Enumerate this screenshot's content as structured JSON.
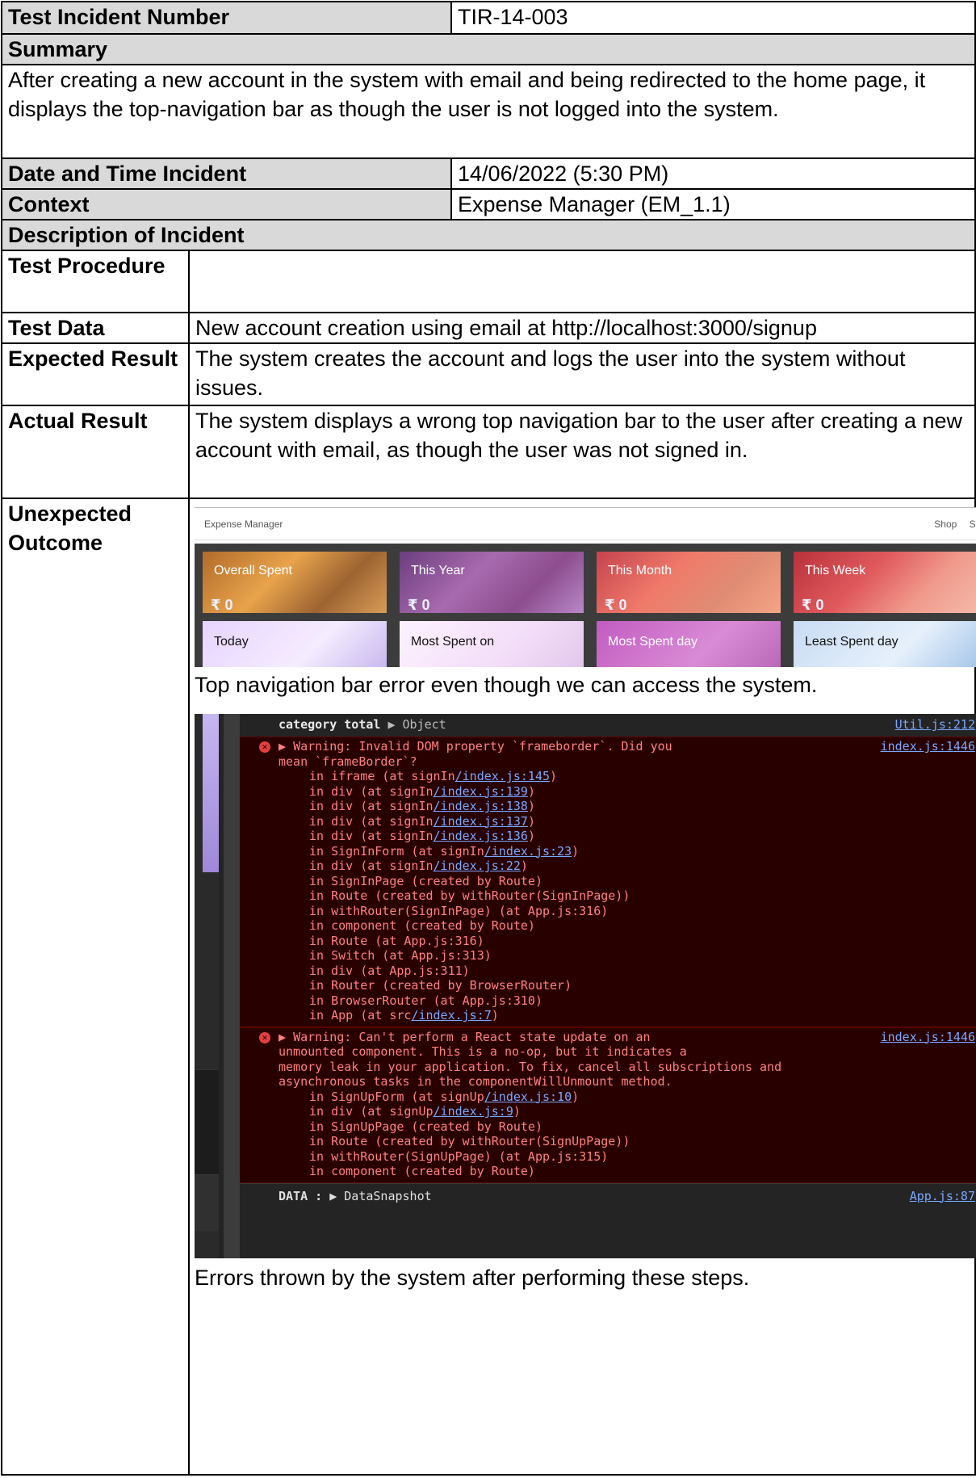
{
  "header": {
    "label": "Test Incident Number",
    "value": "TIR-14-003"
  },
  "summary": {
    "label": "Summary",
    "text": "After creating a new account in the system with email and being redirected to the home page, it displays the top-navigation bar as though the user is not logged into the system."
  },
  "date_time": {
    "label": "Date and Time Incident",
    "value": "14/06/2022 (5:30 PM)"
  },
  "context": {
    "label": "Context",
    "value": "Expense Manager (EM_1.1)"
  },
  "description": {
    "label": "Description of Incident"
  },
  "rows": {
    "procedure_label": "Test Procedure",
    "procedure_value": "",
    "test_data_label": "Test Data",
    "test_data_value": "New account creation using email at http://localhost:3000/signup",
    "expected_label": "Expected Result",
    "expected_value": "The system creates the account and logs the user into the system without issues.",
    "actual_label": "Actual Result",
    "actual_value": "The system displays a wrong top navigation bar to the user after creating a new account with email, as though the user was not signed in.",
    "unexpected_label": "Unexpected Outcome"
  },
  "shot1": {
    "app_title": "Expense Manager",
    "nav_shop": "Shop",
    "nav_signin": "Sign In",
    "tiles": [
      {
        "label": "Overall Spent",
        "amount": "₹ 0"
      },
      {
        "label": "This Year",
        "amount": "₹ 0"
      },
      {
        "label": "This Month",
        "amount": "₹ 0"
      },
      {
        "label": "This Week",
        "amount": "₹ 0"
      },
      {
        "label": "Today"
      },
      {
        "label": "Most Spent on"
      },
      {
        "label": "Most Spent day"
      },
      {
        "label": "Least Spent day"
      }
    ],
    "caption": "Top navigation bar error even though we can access the system."
  },
  "shot2": {
    "first_row_key": "category total",
    "first_row_obj": "Object",
    "first_row_src": "Util.js:212",
    "error1": {
      "line1": "Warning: Invalid DOM property `frameborder`. Did you",
      "line2": "mean `frameBorder`?",
      "src": "index.js:1446",
      "stack": [
        [
          "in iframe (at signIn",
          "/index.js:145",
          ")"
        ],
        [
          "in div (at signIn",
          "/index.js:139",
          ")"
        ],
        [
          "in div (at signIn",
          "/index.js:138",
          ")"
        ],
        [
          "in div (at signIn",
          "/index.js:137",
          ")"
        ],
        [
          "in div (at signIn",
          "/index.js:136",
          ")"
        ],
        [
          "in SignInForm (at signIn",
          "/index.js:23",
          ")"
        ],
        [
          "in div (at signIn",
          "/index.js:22",
          ")"
        ],
        [
          "in SignInPage (created by Route)",
          "",
          ""
        ],
        [
          "in Route (created by withRouter(SignInPage))",
          "",
          ""
        ],
        [
          "in withRouter(SignInPage) (at App.js:316)",
          "",
          ""
        ],
        [
          "in component (created by Route)",
          "",
          ""
        ],
        [
          "in Route (at App.js:316)",
          "",
          ""
        ],
        [
          "in Switch (at App.js:313)",
          "",
          ""
        ],
        [
          "in div (at App.js:311)",
          "",
          ""
        ],
        [
          "in Router (created by BrowserRouter)",
          "",
          ""
        ],
        [
          "in BrowserRouter (at App.js:310)",
          "",
          ""
        ],
        [
          "in App (at src",
          "/index.js:7",
          ")"
        ]
      ]
    },
    "error2": {
      "line1": "Warning: Can't perform a React state update on an",
      "line2": "unmounted component. This is a no-op, but it indicates a",
      "line3": "memory leak in your application. To fix, cancel all subscriptions and",
      "line4": "asynchronous tasks in the componentWillUnmount method.",
      "src": "index.js:1446",
      "stack": [
        [
          "in SignUpForm (at signUp",
          "/index.js:10",
          ")"
        ],
        [
          "in div (at signUp",
          "/index.js:9",
          ")"
        ],
        [
          "in SignUpPage (created by Route)",
          "",
          ""
        ],
        [
          "in Route (created by withRouter(SignUpPage))",
          "",
          ""
        ],
        [
          "in withRouter(SignUpPage) (at App.js:315)",
          "",
          ""
        ],
        [
          "in component (created by Route)",
          "",
          ""
        ]
      ]
    },
    "last_row_key": "DATA :",
    "last_row_obj": "DataSnapshot",
    "last_row_src": "App.js:87",
    "caption": "Errors thrown by the system after performing these steps."
  }
}
